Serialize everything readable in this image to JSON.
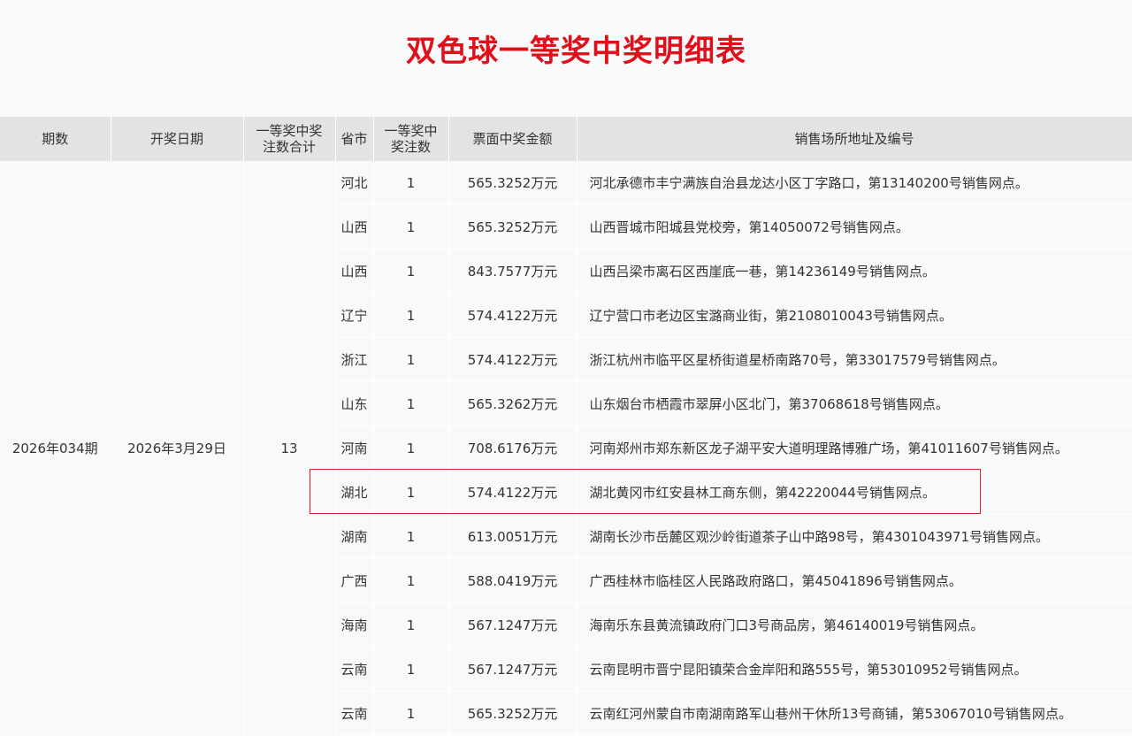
{
  "page": {
    "title": "双色球一等奖中奖明细表"
  },
  "table": {
    "headers": {
      "period": "期数",
      "date": "开奖日期",
      "total": "一等奖中奖注数合计",
      "province": "省市",
      "count": "一等奖中奖注数",
      "amount": "票面中奖金额",
      "address": "销售场所地址及编号"
    },
    "period": "2026年034期",
    "date": "2026年3月29日",
    "total": "13",
    "rows": [
      {
        "province": "河北",
        "count": "1",
        "amount": "565.3252万元",
        "address": "河北承德市丰宁满族自治县龙达小区丁字路口，第13140200号销售网点。"
      },
      {
        "province": "山西",
        "count": "1",
        "amount": "565.3252万元",
        "address": "山西晋城市阳城县党校旁，第14050072号销售网点。"
      },
      {
        "province": "山西",
        "count": "1",
        "amount": "843.7577万元",
        "address": "山西吕梁市离石区西崖底一巷，第14236149号销售网点。"
      },
      {
        "province": "辽宁",
        "count": "1",
        "amount": "574.4122万元",
        "address": "辽宁营口市老边区宝潞商业街，第2108010043号销售网点。"
      },
      {
        "province": "浙江",
        "count": "1",
        "amount": "574.4122万元",
        "address": "浙江杭州市临平区星桥街道星桥南路70号，第33017579号销售网点。"
      },
      {
        "province": "山东",
        "count": "1",
        "amount": "565.3262万元",
        "address": "山东烟台市栖霞市翠屏小区北门，第37068618号销售网点。"
      },
      {
        "province": "河南",
        "count": "1",
        "amount": "708.6176万元",
        "address": "河南郑州市郑东新区龙子湖平安大道明理路博雅广场，第41011607号销售网点。"
      },
      {
        "province": "湖北",
        "count": "1",
        "amount": "574.4122万元",
        "address": "湖北黄冈市红安县林工商东侧，第42220044号销售网点。"
      },
      {
        "province": "湖南",
        "count": "1",
        "amount": "613.0051万元",
        "address": "湖南长沙市岳麓区观沙岭街道茶子山中路98号，第4301043971号销售网点。"
      },
      {
        "province": "广西",
        "count": "1",
        "amount": "588.0419万元",
        "address": "广西桂林市临桂区人民路政府路口，第45041896号销售网点。"
      },
      {
        "province": "海南",
        "count": "1",
        "amount": "567.1247万元",
        "address": "海南乐东县黄流镇政府门口3号商品房，第46140019号销售网点。"
      },
      {
        "province": "云南",
        "count": "1",
        "amount": "567.1247万元",
        "address": "云南昆明市晋宁昆阳镇荣合金岸阳和路555号，第53010952号销售网点。"
      },
      {
        "province": "云南",
        "count": "1",
        "amount": "565.3252万元",
        "address": "云南红河州蒙自市南湖南路军山巷州干休所13号商铺，第53067010号销售网点。"
      }
    ]
  },
  "colors": {
    "title": "#e0101a",
    "header_bg": "#e3e3e3",
    "body_bg": "#f8f9fb",
    "highlight_border": "#e01f26"
  }
}
